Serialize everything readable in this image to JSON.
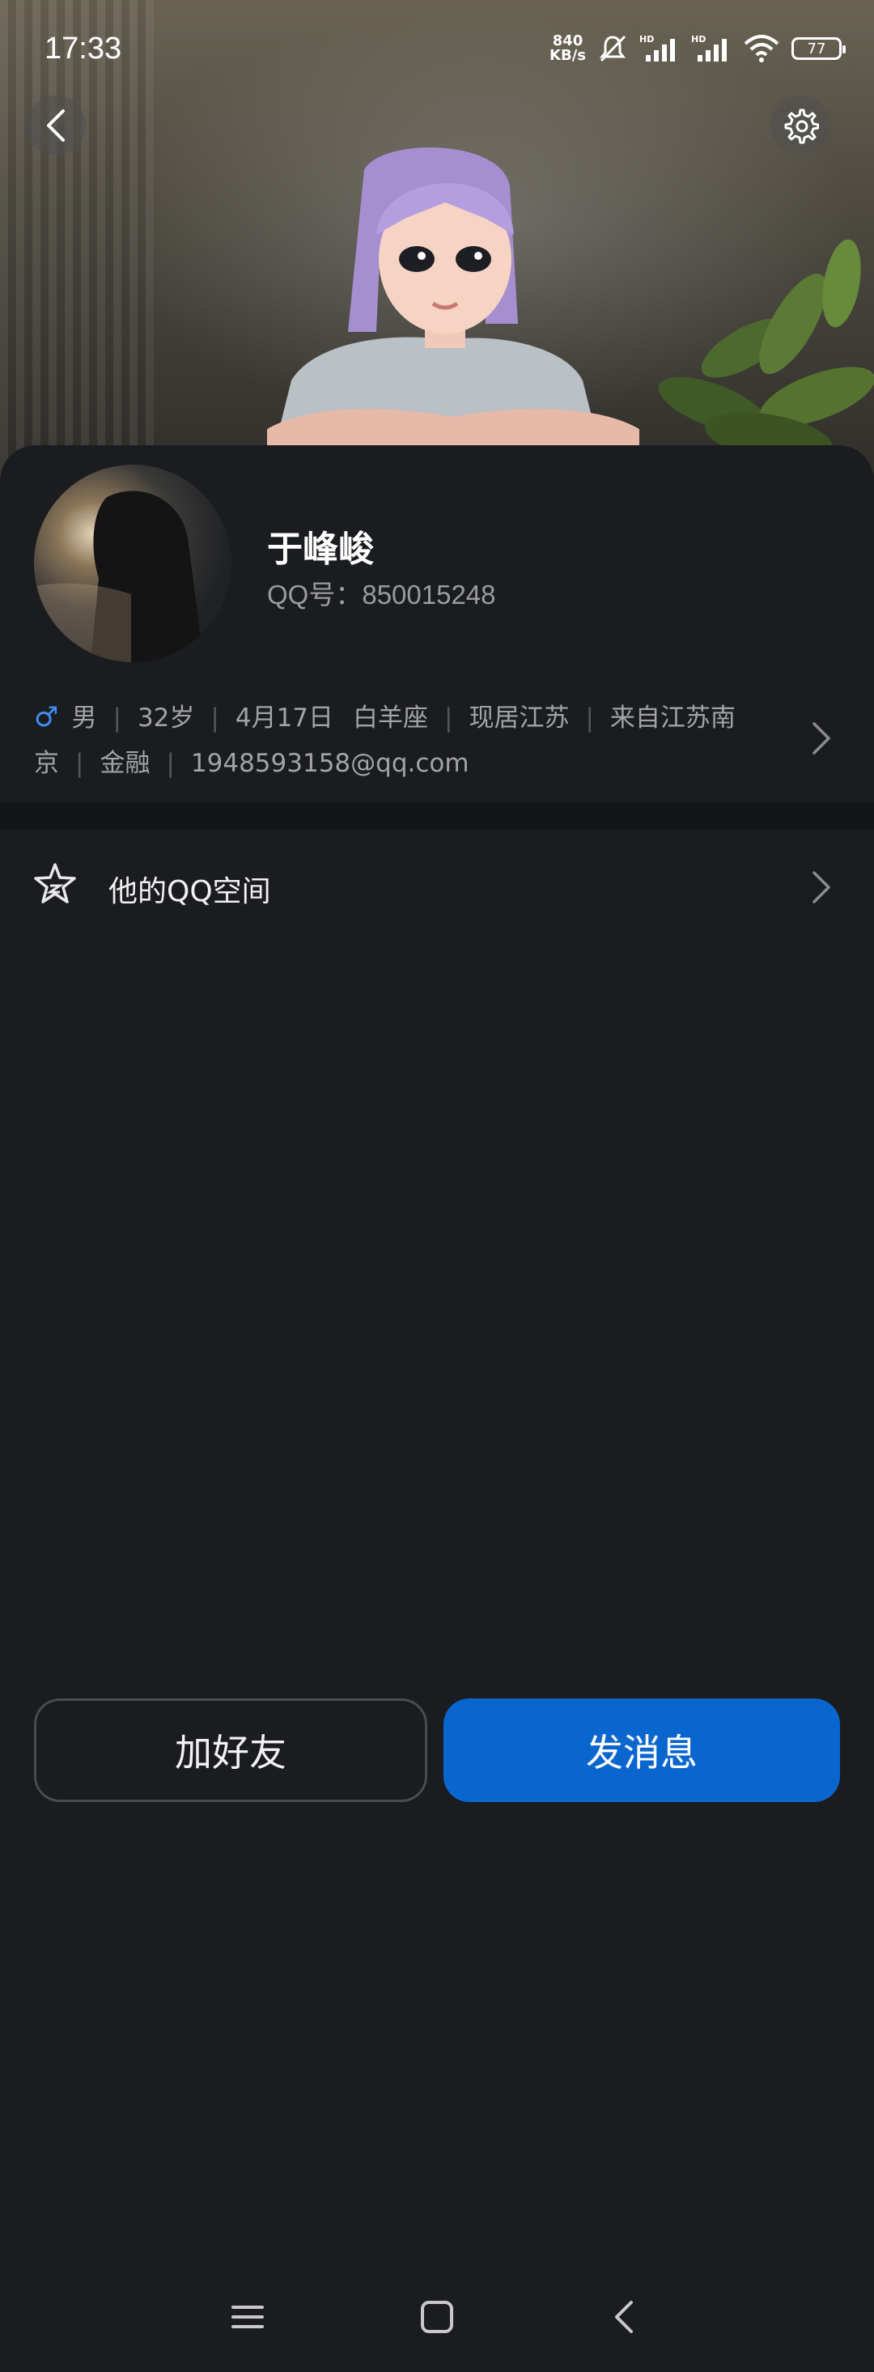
{
  "status_bar": {
    "time": "17:33",
    "net_speed_value": "840",
    "net_speed_unit": "KB/s",
    "battery": "77"
  },
  "header": {
    "back_icon": "chevron-left-icon",
    "settings_icon": "gear-icon"
  },
  "profile": {
    "name": "于峰峻",
    "qq_number": "QQ号：850015248"
  },
  "details": {
    "gender_icon": "♂",
    "gender": "男",
    "age": "32岁",
    "birthday": "4月17日",
    "zodiac": "白羊座",
    "residence": "现居江苏",
    "hometown": "来自江苏南京",
    "occupation": "金融",
    "email": "1948593158@qq.com"
  },
  "menu": {
    "qzone_label": "他的QQ空间"
  },
  "actions": {
    "add_friend": "加好友",
    "send_message": "发消息"
  },
  "colors": {
    "accent": "#0a66cf",
    "background": "#1b1c1f",
    "gender_male": "#3e8ef0"
  }
}
